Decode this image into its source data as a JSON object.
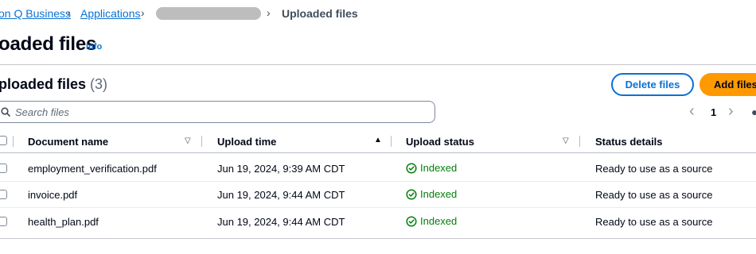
{
  "breadcrumb": {
    "items": [
      {
        "label": "on Q Business"
      },
      {
        "label": "Applications"
      },
      {
        "label": ""
      },
      {
        "label": "Uploaded files"
      }
    ]
  },
  "page": {
    "title": "oaded files",
    "info_label": "Info"
  },
  "section": {
    "title": "ploaded files",
    "count": "(3)",
    "delete_label": "Delete files",
    "add_label": "Add files"
  },
  "search": {
    "placeholder": "Search files",
    "value": ""
  },
  "pagination": {
    "current_page": "1"
  },
  "table": {
    "columns": [
      {
        "label": "Document name",
        "sort": "descending-filter"
      },
      {
        "label": "Upload time",
        "sort": "ascending"
      },
      {
        "label": "Upload status",
        "sort": "descending-filter"
      },
      {
        "label": "Status details"
      }
    ],
    "rows": [
      {
        "name": "employment_verification.pdf",
        "time": "Jun 19, 2024, 9:39 AM CDT",
        "status": "Indexed",
        "details": "Ready to use as a source"
      },
      {
        "name": "invoice.pdf",
        "time": "Jun 19, 2024, 9:44 AM CDT",
        "status": "Indexed",
        "details": "Ready to use as a source"
      },
      {
        "name": "health_plan.pdf",
        "time": "Jun 19, 2024, 9:44 AM CDT",
        "status": "Indexed",
        "details": "Ready to use as a source"
      }
    ]
  },
  "colors": {
    "link": "#0972d3",
    "primary": "#ff9900",
    "success": "#037f0c"
  },
  "icons": {
    "search": "search-icon",
    "chevron_left": "chevron-left-icon",
    "chevron_right": "chevron-right-icon",
    "check_circle": "check-circle-icon",
    "sort": "sort-caret-icon"
  }
}
